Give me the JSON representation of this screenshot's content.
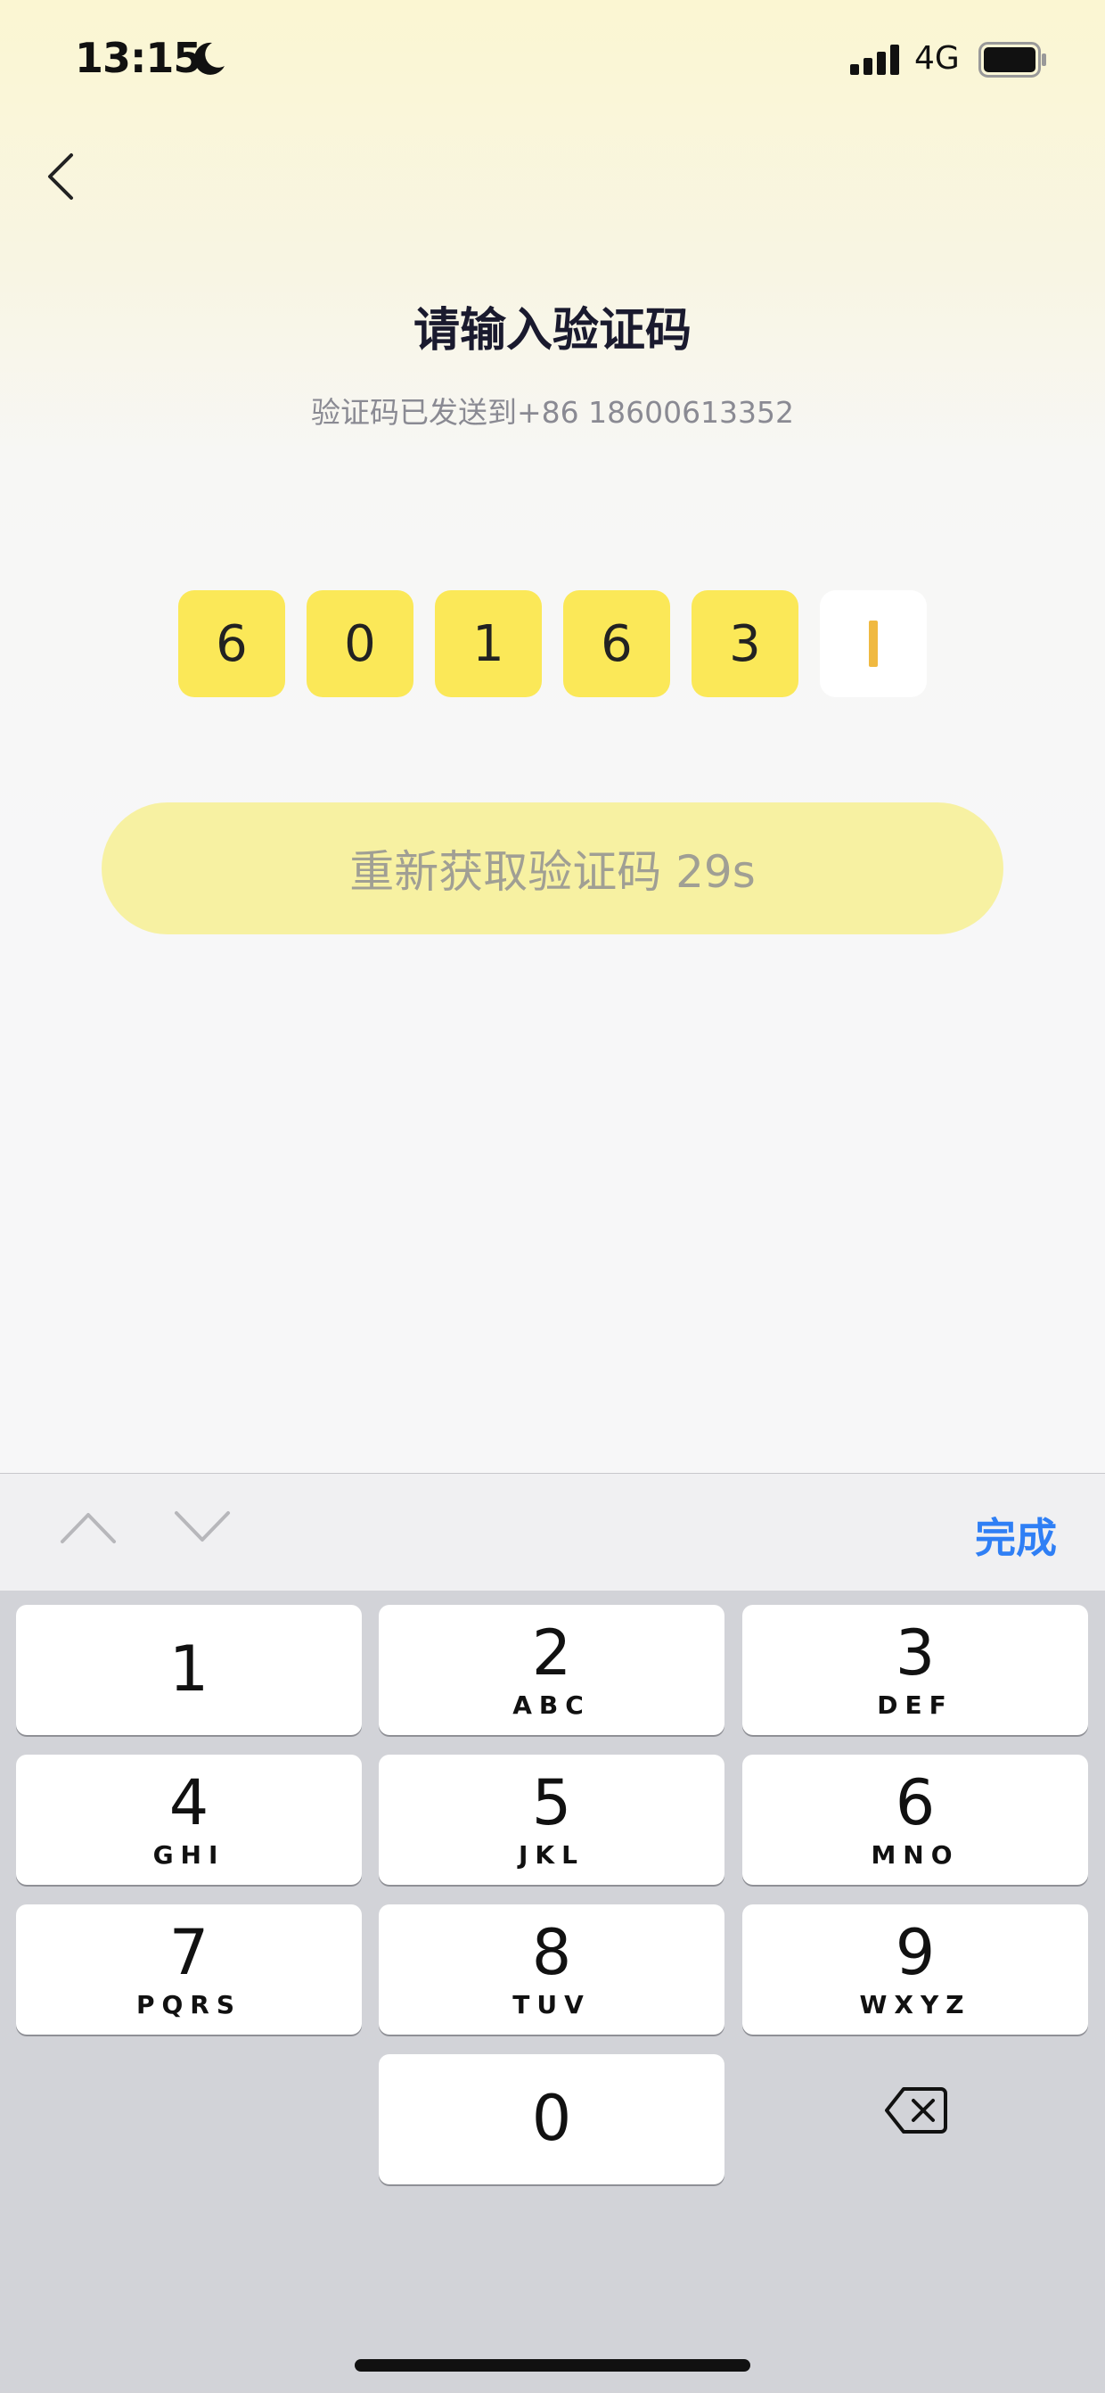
{
  "status_bar": {
    "time": "13:15",
    "network": "4G",
    "moon_icon": "moon-icon",
    "signal_icon": "signal-icon",
    "battery_icon": "battery-icon"
  },
  "header": {
    "title": "请输入验证码",
    "subtitle": "验证码已发送到+86 18600613352"
  },
  "code": {
    "digits": [
      "6",
      "0",
      "1",
      "6",
      "3",
      ""
    ]
  },
  "resend": {
    "label": "重新获取验证码 29s"
  },
  "accessory": {
    "done_label": "完成"
  },
  "keypad": {
    "keys": [
      {
        "digit": "1",
        "letters": ""
      },
      {
        "digit": "2",
        "letters": "ABC"
      },
      {
        "digit": "3",
        "letters": "DEF"
      },
      {
        "digit": "4",
        "letters": "GHI"
      },
      {
        "digit": "5",
        "letters": "JKL"
      },
      {
        "digit": "6",
        "letters": "MNO"
      },
      {
        "digit": "7",
        "letters": "PQRS"
      },
      {
        "digit": "8",
        "letters": "TUV"
      },
      {
        "digit": "9",
        "letters": "WXYZ"
      },
      {
        "digit": "0",
        "letters": ""
      }
    ]
  },
  "colors": {
    "accent_yellow": "#fbe858",
    "caret": "#f0b941",
    "done_blue": "#2f7ff5"
  }
}
